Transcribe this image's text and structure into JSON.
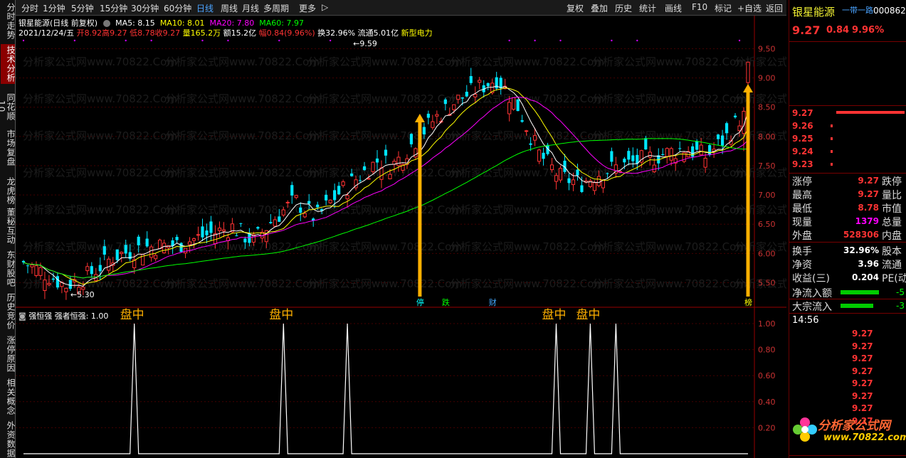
{
  "left_tabs": [
    "分时走势",
    "技术分析",
    "同花顺10",
    "市场复盘",
    "龙虎榜",
    "董秘互动",
    "东财股吧",
    "历史竞价",
    "涨停原因",
    "相关概念",
    "外资数据"
  ],
  "toolbar": {
    "periods": [
      "分时",
      "1分钟",
      "5分钟",
      "15分钟",
      "30分钟",
      "60分钟",
      "日线",
      "周线",
      "月线",
      "多周期",
      "更多"
    ],
    "active": "日线",
    "right": [
      "复权",
      "叠加",
      "历史",
      "统计",
      "画线",
      "F10",
      "标记",
      "+自选",
      "返回"
    ]
  },
  "stock": {
    "name": "银星能源",
    "mode": "(日线 前复权)",
    "ma5": "MA5: 8.15",
    "ma10": "MA10: 8.01",
    "ma20": "MA20: 7.80",
    "ma60": "MA60: 7.97",
    "date": "2021/12/24/五",
    "open": "开8.92",
    "high": "高9.27",
    "low": "低8.78",
    "close": "收9.27",
    "vol": "量165.2万",
    "amount": "额15.2亿",
    "change": "幅0.84(9.96%)",
    "turnover": "换32.96%",
    "float": "流通5.01亿",
    "concept": "新型电力"
  },
  "price_axis": [
    "9.50",
    "9.00",
    "8.50",
    "8.00",
    "7.50",
    "7.00",
    "6.50",
    "6.00",
    "5.50"
  ],
  "annotations": {
    "high_mark": "9.59",
    "low_mark": "5.30"
  },
  "event_tags": [
    "停",
    "跌",
    "财",
    "榜"
  ],
  "indicator": {
    "title": "强恒强",
    "param": "强者恒强: 1.00",
    "signal_label": "盘中",
    "axis": [
      "1.00",
      "0.80",
      "0.60",
      "0.40",
      "0.20"
    ],
    "spikes": [
      {
        "bar": 32,
        "label": "盘中"
      },
      {
        "bar": 75,
        "label": "盘中"
      },
      {
        "bar": 93,
        "label": ""
      },
      {
        "bar": 153,
        "label": "盘中"
      },
      {
        "bar": 163,
        "label": "盘中"
      },
      {
        "bar": 170,
        "label": ""
      }
    ]
  },
  "watermark": "分析家公式网www.70822.Com",
  "quote": {
    "name": "银星能源",
    "tag": "一带一路",
    "code": "000862",
    "price": "9.27",
    "change": "0.84",
    "pct": "9.96%",
    "order_book": [
      {
        "price": "9.27",
        "vol_pct": 1.0
      },
      {
        "price": "9.26",
        "vol_pct": 0.02
      },
      {
        "price": "9.25",
        "vol_pct": 0.02
      },
      {
        "price": "9.24",
        "vol_pct": 0.02
      },
      {
        "price": "9.23",
        "vol_pct": 0.02
      }
    ],
    "stats": [
      {
        "l1": "涨停",
        "v1": "9.27",
        "l2": "跌停"
      },
      {
        "l1": "最高",
        "v1": "9.27",
        "l2": "量比"
      },
      {
        "l1": "最低",
        "v1": "8.78",
        "l2": "市值"
      },
      {
        "l1": "现量",
        "v1": "1379",
        "l2": "总量"
      },
      {
        "l1": "外盘",
        "v1": "528306",
        "l2": "内盘"
      }
    ],
    "stats2": [
      {
        "l1": "换手",
        "v1": "32.96%",
        "l2": "股本"
      },
      {
        "l1": "净资",
        "v1": "3.96",
        "l2": "流通"
      },
      {
        "l1": "收益(三)",
        "v1": "0.204",
        "l2": "PE(动)"
      }
    ],
    "flow": [
      {
        "label": "净流入额",
        "val": "-5"
      },
      {
        "label": "大宗流入",
        "val": "-3"
      }
    ],
    "time": "14:56",
    "ticks": [
      "9.27",
      "9.27",
      "9.27",
      "9.27",
      "9.27",
      "9.27",
      "9.27",
      "9.27"
    ],
    "logo_text": "分析家公式网",
    "logo_url": "www.70822.com"
  },
  "colors": {
    "up": "#ff3333",
    "down": "#00e5ff",
    "ma5": "#ffffff",
    "ma10": "#ffff00",
    "ma20": "#ff00ff",
    "ma60": "#00ff00",
    "arrow": "#ffb000"
  }
}
